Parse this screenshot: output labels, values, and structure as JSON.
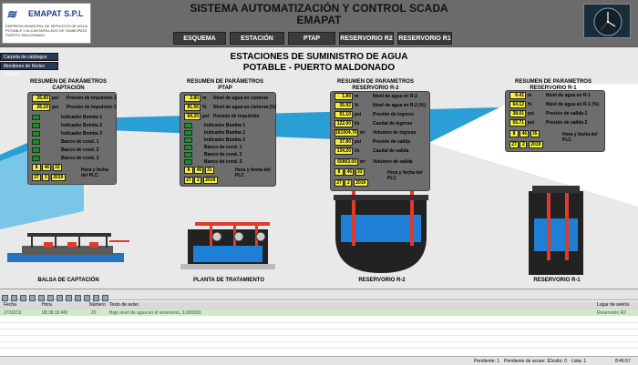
{
  "header": {
    "title_line1": "SISTEMA AUTOMATIZACIÓN Y CONTROL SCADA",
    "title_line2": "EMAPAT",
    "logo_name": "EMAPAT S.P.L",
    "logo_sub": "EMPRESA MUNICIPAL DE SERVICIOS DE AGUA POTABLE Y ALCANTARILLADO DE TAMBOPATA PUERTO MALDONADO",
    "nav": [
      "ESQUEMA",
      "ESTACIÓN BALSA",
      "PTAP",
      "RESERVORIO R2",
      "RESERVORIO R1"
    ]
  },
  "sidebar": {
    "items": [
      "Carpeta de catálogos",
      "Monitoreo de Redes (Widex)"
    ]
  },
  "main": {
    "title_line1": "ESTACIONES DE SUMINISTRO DE AGUA",
    "title_line2": "POTABLE - PUERTO MALDONADO"
  },
  "panels": {
    "captacion": {
      "title1": "RESUMEN DE PARÁMETROS",
      "title2": "CAPTACIÓN",
      "measures": [
        {
          "value": "26.80",
          "unit": "psi",
          "label": "Presión de Impulsión 1"
        },
        {
          "value": "26.10",
          "unit": "psi",
          "label": "Presión de Impulsión 2"
        }
      ],
      "indicators": [
        "Indicador Bomba 1",
        "Indicador Bomba 2",
        "Indicador Bomba 3",
        "Banco de cond. 1",
        "Banco de cond. 2",
        "Banco de cond. 3"
      ],
      "time": [
        "8",
        "46",
        "33"
      ],
      "date": [
        "27",
        "2",
        "2019"
      ],
      "time_label": "Hora y fecha del PLC"
    },
    "ptap": {
      "title1": "RESUMEN DE PARÁMETROS",
      "title2": "PTAP",
      "measures": [
        {
          "value": "2.80",
          "unit": "m",
          "label": "Nivel de agua en cisterna"
        },
        {
          "value": "81.56",
          "unit": "%",
          "label": "Nivel de agua en cisterna (%)"
        },
        {
          "value": "64.20",
          "unit": "psi",
          "label": "Presión de Impulsión"
        }
      ],
      "indicators": [
        "Indicador Bomba 1",
        "Indicador Bomba 2",
        "Indicador Bomba 3",
        "Banco de cond. 1",
        "Banco de cond. 2",
        "Banco de cond. 3"
      ],
      "time": [
        "8",
        "46",
        "31"
      ],
      "date": [
        "27",
        "2",
        "2019"
      ],
      "time_label": "Hora y fecha del PLC"
    },
    "r2": {
      "title1": "RESUMEN DE PARAMETROS",
      "title2": "RESERVORIO R-2",
      "measures": [
        {
          "value": "1.89",
          "unit": "m",
          "label": "Nivel de agua en R-2"
        },
        {
          "value": "35.92",
          "unit": "%",
          "label": "Nivel de agua en R-2 (%)"
        },
        {
          "value": "51.10",
          "unit": "psi",
          "label": "Presión de ingreso"
        },
        {
          "value": "122.00",
          "unit": "l/s",
          "label": "Caudal de ingreso"
        },
        {
          "value": "161004.70",
          "unit": "m³",
          "label": "Volumen de ingreso"
        },
        {
          "value": "37.80",
          "unit": "psi",
          "label": "Presión de salida"
        },
        {
          "value": "134.20",
          "unit": "l/s",
          "label": "Caudal de salida"
        },
        {
          "value": "65803.00",
          "unit": "m³",
          "label": "Volumen de salida"
        }
      ],
      "time": [
        "8",
        "46",
        "33"
      ],
      "date": [
        "27",
        "2",
        "2019"
      ],
      "time_label": "Hora y fecha del PLC"
    },
    "r1": {
      "title1": "RESUMEN DE PARAMETROS",
      "title2": "RESERVORIO R-1",
      "measures": [
        {
          "value": "6.41",
          "unit": "m",
          "label": "Nivel de agua en R-1"
        },
        {
          "value": "64.12",
          "unit": "%",
          "label": "Nivel de agua en R-1 (%)"
        },
        {
          "value": "38.01",
          "unit": "psi",
          "label": "Presión de salida 1"
        },
        {
          "value": "55.71",
          "unit": "psi",
          "label": "Presión de salida 2"
        }
      ],
      "time": [
        "8",
        "46",
        "35"
      ],
      "date": [
        "27",
        "2",
        "2019"
      ],
      "time_label": "Hora y fecha del PLC"
    }
  },
  "captions": {
    "balsa": "BALSA DE CAPTACIÓN",
    "planta": "PLANTA DE TRATAMIENTO",
    "r2": "RESERVORIO R-2",
    "r1": "RESERVORIO R-1"
  },
  "alarms": {
    "columns": [
      "Fecha",
      "Hora",
      "Número",
      "Texto de aviso",
      "Lugar de avería"
    ],
    "row": {
      "date": "27/02/19",
      "time": "08:38:18 AM",
      "number": "20",
      "text": "Bajo nivel de agua en el reservorio, 3,900000",
      "place": "Reservorio R2"
    },
    "status": {
      "pending": "Pendiente: 1",
      "pending_ack": "Pendiente de acuse: 1",
      "hidden": "Oculto: 0",
      "list": "Lista: 1",
      "clock": "8:46:57"
    }
  },
  "colors": {
    "value_box": "#f5ef3a",
    "panel": "#6d6d6d",
    "led_on": "#1c8b2e",
    "water": "#1e7fd6",
    "pipe": "#e03a2a",
    "alarm_row": "#cfe9c9"
  }
}
